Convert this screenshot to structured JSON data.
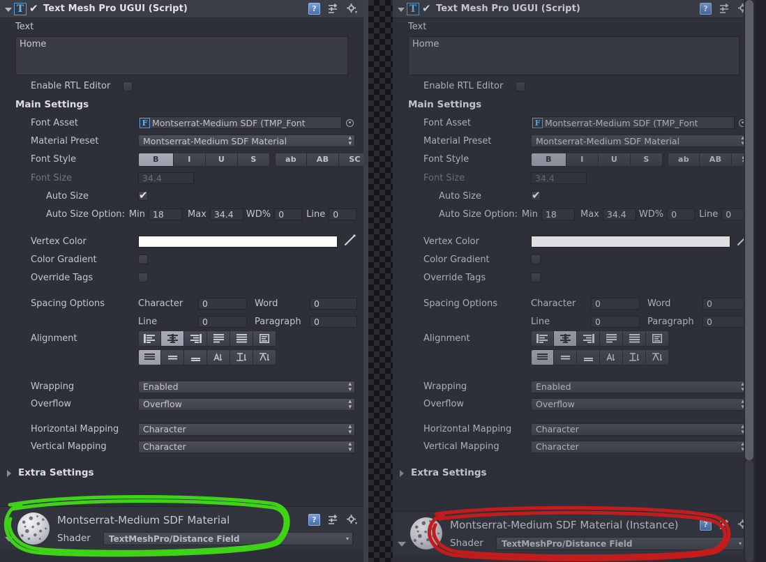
{
  "component": {
    "title": "Text Mesh Pro UGUI (Script)",
    "script_icon": "T",
    "enabled": true,
    "help_icon": "help-icon",
    "preset_icon": "preset-icon",
    "gear_icon": "gear-icon"
  },
  "text_section": {
    "label": "Text",
    "value": "Home",
    "rtl_label": "Enable RTL Editor",
    "rtl_checked": false
  },
  "main_settings": {
    "header": "Main Settings",
    "font_asset": {
      "label": "Font Asset",
      "value": "Montserrat-Medium SDF (TMP_Font",
      "badge": "F"
    },
    "material_preset": {
      "label": "Material Preset",
      "value": "Montserrat-Medium SDF Material"
    },
    "font_style": {
      "label": "Font Style",
      "buttons": [
        "B",
        "I",
        "U",
        "S",
        "ab",
        "AB",
        "SC"
      ],
      "active": 0
    },
    "font_size": {
      "label": "Font Size",
      "value": "34.4",
      "disabled": true
    },
    "auto_size": {
      "label": "Auto Size",
      "checked": true
    },
    "auto_size_option": {
      "label": "Auto Size Option:",
      "min_label": "Min",
      "min_value": "18",
      "max_label": "Max",
      "max_value": "34.4",
      "wd_label": "WD%",
      "wd_value": "0",
      "line_label": "Line",
      "line_value": "0"
    },
    "vertex_color": {
      "label": "Vertex Color",
      "value": "#FFFFFF",
      "eyedropper": "eyedropper-icon"
    },
    "color_gradient": {
      "label": "Color Gradient",
      "checked": false
    },
    "override_tags": {
      "label": "Override Tags",
      "checked": false
    },
    "spacing_options": {
      "label": "Spacing Options",
      "character_label": "Character",
      "character_value": "0",
      "word_label": "Word",
      "word_value": "0",
      "line_label": "Line",
      "line_value": "0",
      "paragraph_label": "Paragraph",
      "paragraph_value": "0"
    },
    "alignment": {
      "label": "Alignment",
      "horizontal": [
        "align-left",
        "align-center",
        "align-right",
        "align-justified",
        "align-flush",
        "align-geometry"
      ],
      "horizontal_active": 1,
      "vertical": [
        "align-top",
        "align-middle",
        "align-bottom",
        "align-baseline",
        "align-midline",
        "align-capline"
      ],
      "vertical_active": 0
    },
    "wrapping": {
      "label": "Wrapping",
      "value": "Enabled"
    },
    "overflow": {
      "label": "Overflow",
      "value": "Overflow"
    },
    "horizontal_mapping": {
      "label": "Horizontal Mapping",
      "value": "Character"
    },
    "vertical_mapping": {
      "label": "Vertical Mapping",
      "value": "Character"
    }
  },
  "extra_settings": {
    "label": "Extra Settings",
    "expanded": false
  },
  "material_left": {
    "name": "Montserrat-Medium SDF Material",
    "shader_label": "Shader",
    "shader_value": "TextMeshPro/Distance Field"
  },
  "material_right": {
    "name": "Montserrat-Medium SDF Material (Instance)",
    "shader_label": "Shader",
    "shader_value": "TextMeshPro/Distance Field"
  },
  "annotations": {
    "left_ellipse_color": "#3fd318",
    "right_ellipse_color": "#c41c1c"
  }
}
